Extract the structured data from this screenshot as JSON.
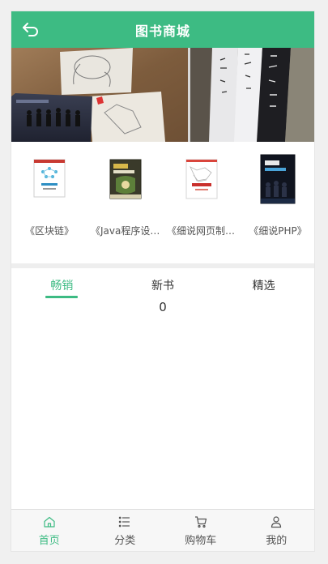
{
  "theme": {
    "accent": "#3dbb83"
  },
  "header": {
    "title": "图书商城",
    "back_icon": "back-arrow-icon"
  },
  "books": [
    {
      "name": "《区块链》",
      "cover_icon": "book-cover-blockchain"
    },
    {
      "name": "《Java程序设计》",
      "cover_icon": "book-cover-java"
    },
    {
      "name": "《细说网页制作》",
      "cover_icon": "book-cover-webpage"
    },
    {
      "name": "《细说PHP》",
      "cover_icon": "book-cover-php"
    }
  ],
  "tabs": [
    {
      "label": "畅销",
      "active": true
    },
    {
      "label": "新书",
      "active": false
    },
    {
      "label": "精选",
      "active": false
    }
  ],
  "content": {
    "count": "0"
  },
  "tabbar": [
    {
      "label": "首页",
      "icon": "home-icon",
      "active": true
    },
    {
      "label": "分类",
      "icon": "list-icon",
      "active": false
    },
    {
      "label": "购物车",
      "icon": "cart-icon",
      "active": false
    },
    {
      "label": "我的",
      "icon": "user-icon",
      "active": false
    }
  ]
}
